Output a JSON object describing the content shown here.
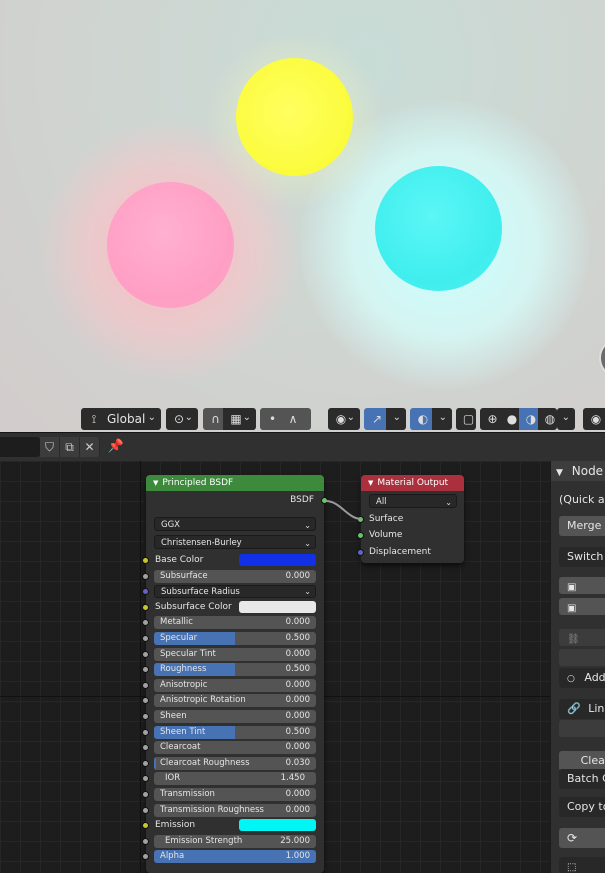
{
  "viewport": {
    "header": {
      "transform_orientation": "Global"
    }
  },
  "node_editor": {
    "header": {
      "icons": [
        "shield-icon",
        "duplicate-icon",
        "close-icon",
        "pin-icon"
      ]
    },
    "principled_node": {
      "title": "Principled BSDF",
      "output": "BSDF",
      "distribution": "GGX",
      "subsurface_method": "Christensen-Burley",
      "inputs": [
        {
          "label": "Base Color",
          "kind": "color",
          "color": "#1230e6"
        },
        {
          "label": "Subsurface",
          "kind": "value",
          "value": "0.000",
          "fraction": 0
        },
        {
          "label": "Subsurface Radius",
          "kind": "vector"
        },
        {
          "label": "Subsurface Color",
          "kind": "color",
          "color": "#e8e8e8"
        },
        {
          "label": "Metallic",
          "kind": "value",
          "value": "0.000",
          "fraction": 0
        },
        {
          "label": "Specular",
          "kind": "value",
          "value": "0.500",
          "fraction": 0.5
        },
        {
          "label": "Specular Tint",
          "kind": "value",
          "value": "0.000",
          "fraction": 0
        },
        {
          "label": "Roughness",
          "kind": "value",
          "value": "0.500",
          "fraction": 0.5
        },
        {
          "label": "Anisotropic",
          "kind": "value",
          "value": "0.000",
          "fraction": 0
        },
        {
          "label": "Anisotropic Rotation",
          "kind": "value",
          "value": "0.000",
          "fraction": 0
        },
        {
          "label": "Sheen",
          "kind": "value",
          "value": "0.000",
          "fraction": 0
        },
        {
          "label": "Sheen Tint",
          "kind": "value",
          "value": "0.500",
          "fraction": 0.5
        },
        {
          "label": "Clearcoat",
          "kind": "value",
          "value": "0.000",
          "fraction": 0
        },
        {
          "label": "Clearcoat Roughness",
          "kind": "value",
          "value": "0.030",
          "fraction": 0.03
        },
        {
          "label": "IOR",
          "kind": "value",
          "value": "1.450",
          "fraction": 0
        },
        {
          "label": "Transmission",
          "kind": "value",
          "value": "0.000",
          "fraction": 0
        },
        {
          "label": "Transmission Roughness",
          "kind": "value",
          "value": "0.000",
          "fraction": 0
        },
        {
          "label": "Emission",
          "kind": "color",
          "color": "#00f5f5"
        },
        {
          "label": "Emission Strength",
          "kind": "value",
          "value": "25.000",
          "fraction": 0
        },
        {
          "label": "Alpha",
          "kind": "value",
          "value": "1.000",
          "fraction": 1
        }
      ]
    },
    "output_node": {
      "title": "Material Output",
      "target": "All",
      "inputs": [
        "Surface",
        "Volume",
        "Displacement"
      ]
    }
  },
  "sidebar": {
    "panel_title": "Node",
    "quick_access": "(Quick ac",
    "merge_button": "Merge S",
    "switch_button": "Switch l",
    "add_label": "Add",
    "link_label": "Link",
    "clear_button": "Clear",
    "batch_button": "Batch C",
    "copy_button": "Copy to"
  }
}
